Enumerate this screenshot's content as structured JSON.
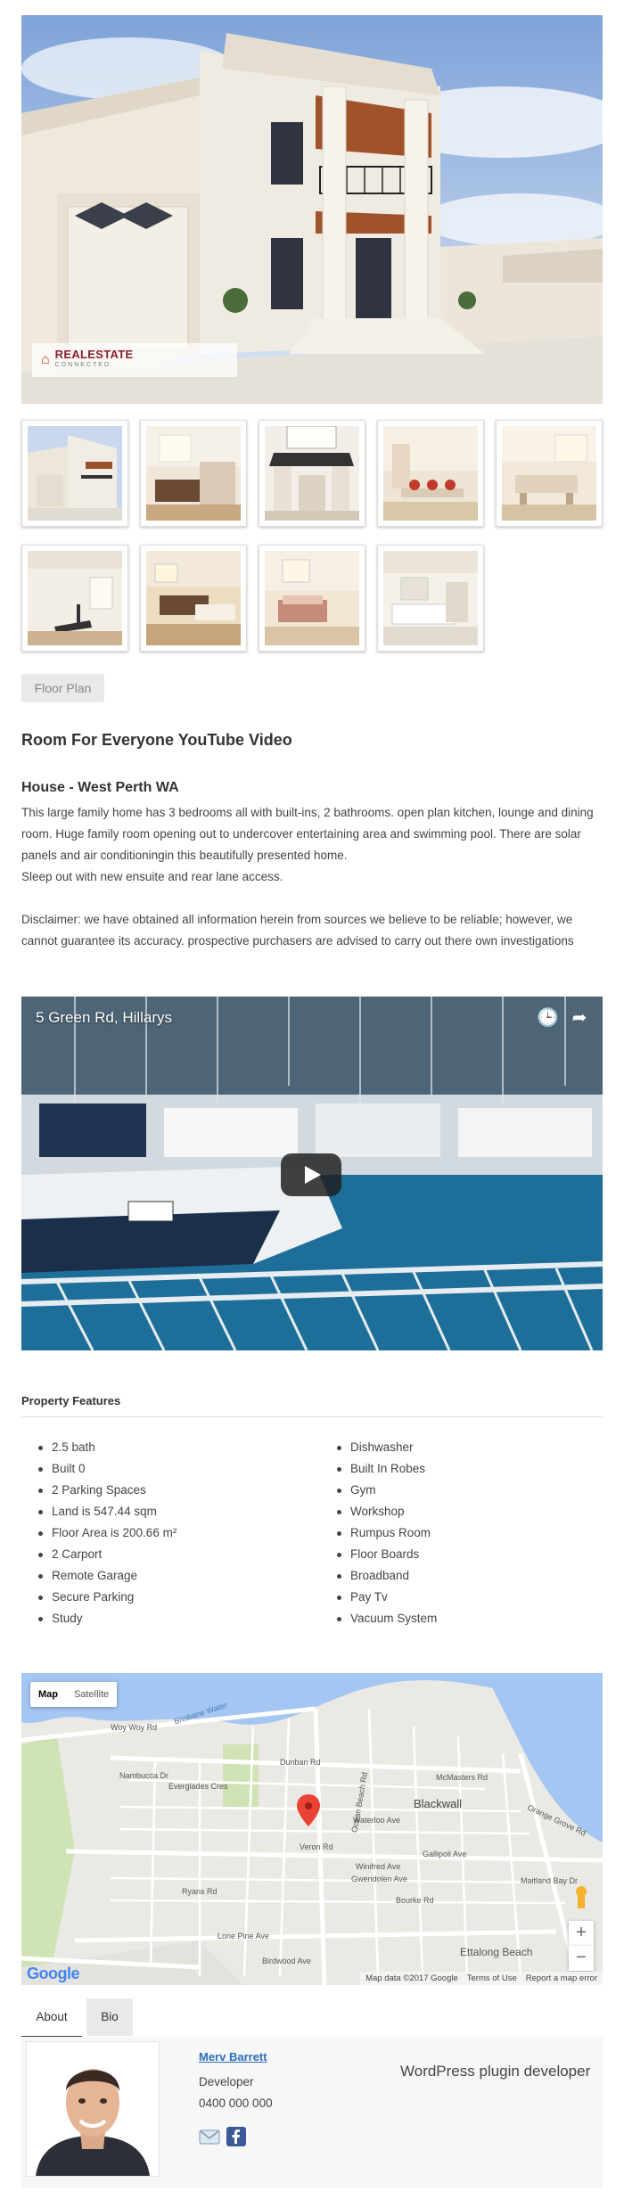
{
  "hero": {
    "brand": "REALESTATE",
    "brand_sub": "CONNECTED"
  },
  "gallery": {
    "thumbnails": [
      "exterior",
      "kitchen",
      "atrium",
      "dining",
      "living",
      "gym",
      "lounge",
      "bedroom",
      "bathroom"
    ],
    "floor_plan_label": "Floor Plan"
  },
  "listing": {
    "video_heading": "Room For Everyone YouTube Video",
    "subtitle": "House - West Perth WA",
    "description_1": "This large family home has 3 bedrooms all with built-ins, 2 bathrooms. open plan kitchen, lounge and dining room. Huge family room opening out to undercover entertaining area and swimming pool. There are solar panels and air conditioningin this beautifully presented home.",
    "description_2": "Sleep out with new ensuite and rear lane access.",
    "disclaimer": "Disclaimer: we have obtained all information herein from sources we believe to be reliable; however, we cannot guarantee its accuracy. prospective purchasers are advised to carry out there own investigations"
  },
  "video": {
    "title": "5 Green Rd, Hillarys"
  },
  "features": {
    "heading": "Property Features",
    "left": [
      "2.5 bath",
      "Built 0",
      "2 Parking Spaces",
      "Land is 547.44 sqm",
      "Floor Area is 200.66 m²",
      "2 Carport",
      "Remote Garage",
      "Secure Parking",
      "Study"
    ],
    "right": [
      "Dishwasher",
      "Built In Robes",
      "Gym",
      "Workshop",
      "Rumpus Room",
      "Floor Boards",
      "Broadband",
      "Pay Tv",
      "Vacuum System"
    ]
  },
  "map": {
    "type_map": "Map",
    "type_satellite": "Satellite",
    "zoom_in": "+",
    "zoom_out": "−",
    "logo": "Google",
    "attribution": "Map data ©2017 Google",
    "terms": "Terms of Use",
    "report": "Report a map error",
    "labels": {
      "river": "Brisbane Water",
      "woy_woy": "Woy Woy Rd",
      "blackwall": "Blackwall",
      "ettalong": "Ettalong Beach",
      "dunban": "Dunban Rd",
      "waterloo": "Waterloo Ave",
      "veron": "Veron Rd",
      "bourke": "Bourke Rd",
      "ryans": "Ryans Rd",
      "lone_pine": "Lone Pine Ave",
      "birdwood": "Birdwood Ave",
      "nambucca": "Nambucca Dr",
      "everglades": "Everglades Cres",
      "mcmasters": "McMasters Rd",
      "orange_grove": "Orange Grove Rd",
      "gallipoli": "Gallipoli Ave",
      "winifred": "Winifred Ave",
      "gwendolen": "Gwendolen Ave",
      "maitland": "Maitland Bay Dr",
      "ocean_beach": "Ocean Beach Rd"
    },
    "accent": "#ea4335"
  },
  "agent": {
    "tabs": [
      "About",
      "Bio"
    ],
    "name": "Merv Barrett",
    "role": "Developer",
    "phone": "0400 000 000",
    "tagline": "WordPress plugin developer",
    "link_color": "#2a6ebb"
  }
}
